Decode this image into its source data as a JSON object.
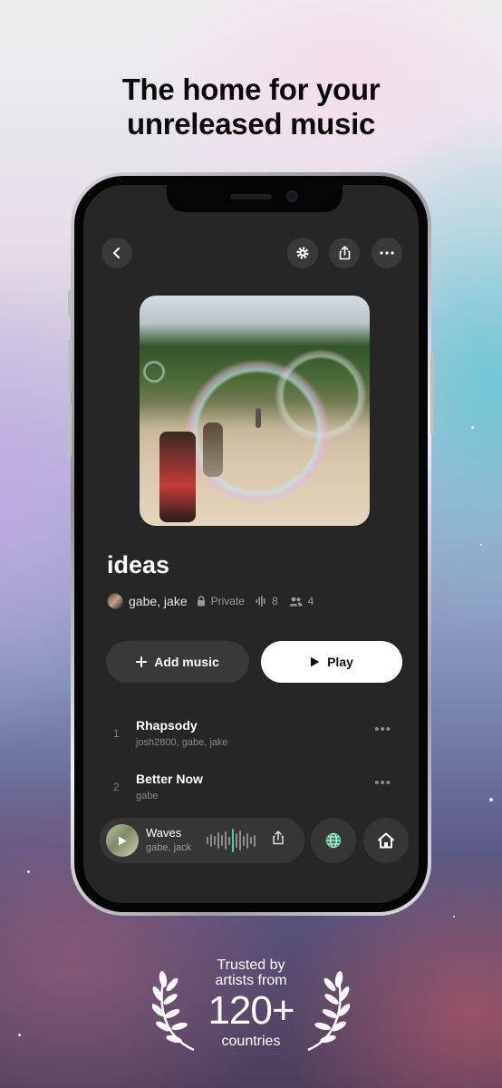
{
  "headline": {
    "line1": "The home for your",
    "line2": "unreleased music"
  },
  "icons": {
    "back": "chevron-left-icon",
    "settings": "gear-icon",
    "share": "share-icon",
    "more": "ellipsis-icon",
    "private": "lock-icon",
    "plays": "waveform-icon",
    "collaborators": "people-icon",
    "add": "plus-icon",
    "play": "play-icon",
    "globe": "globe-icon",
    "home": "home-icon"
  },
  "playlist": {
    "title": "ideas",
    "owners": "gabe, jake",
    "privacy": "Private",
    "plays_count": "8",
    "members_count": "4"
  },
  "actions": {
    "add_music_label": "Add music",
    "play_label": "Play"
  },
  "tracks": [
    {
      "number": "1",
      "title": "Rhapsody",
      "artists": "josh2800, gabe, jake",
      "more": "•••"
    },
    {
      "number": "2",
      "title": "Better Now",
      "artists": "gabe",
      "more": "•••"
    }
  ],
  "now_playing": {
    "title": "Waves",
    "artists": "gabe, jack"
  },
  "trust_badge": {
    "line1": "Trusted by",
    "line2": "artists from",
    "count": "120+",
    "line3": "countries"
  },
  "colors": {
    "accent_waveform": "#37d6a0",
    "screen_bg": "#262626",
    "button_bg": "#393939"
  }
}
